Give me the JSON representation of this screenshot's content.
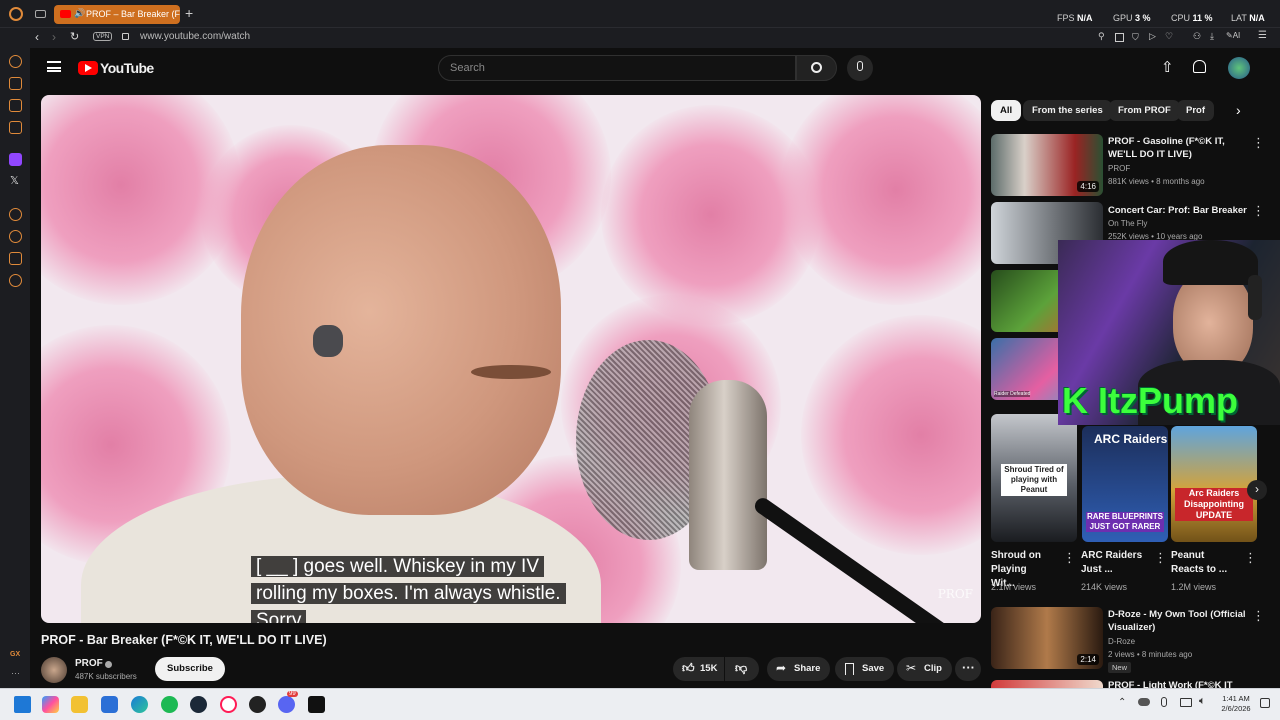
{
  "browser": {
    "tab_title": "PROF – Bar Breaker (F",
    "url": "www.youtube.com/watch",
    "vpn_label": "VPN",
    "stats": {
      "fps_label": "FPS",
      "fps": "N/A",
      "gpu_label": "GPU",
      "gpu": "3 %",
      "cpu_label": "CPU",
      "cpu": "11 %",
      "lat_label": "LAT",
      "lat": "N/A"
    },
    "ai_label": "AI",
    "sidebar_gx": "GX"
  },
  "youtube": {
    "logo_text": "YouTube",
    "search_placeholder": "Search",
    "chips": [
      "All",
      "From the series",
      "From PROF",
      "Prof"
    ],
    "video": {
      "title": "PROF - Bar Breaker (F*©K IT, WE'LL DO IT LIVE)",
      "captions": [
        "[ __ ] goes well. Whiskey in my IV",
        "rolling my boxes. I'm always whistle.",
        "Sorry"
      ],
      "watermark": "PROF",
      "channel": "PROF",
      "subscribers": "487K subscribers",
      "subscribe": "Subscribe",
      "likes": "15K",
      "share": "Share",
      "save": "Save",
      "clip": "Clip"
    },
    "recommendations": [
      {
        "title": "PROF - Gasoline (F*©K IT, WE'LL DO IT LIVE)",
        "channel": "PROF",
        "meta": "881K views • 8 months ago",
        "duration": "4:16"
      },
      {
        "title": "Concert Car: Prof: Bar Breaker",
        "channel": "On The Fly",
        "meta": "252K views • 10 years ago",
        "duration": ""
      },
      {
        "title": "D-Roze - My Own Tool (Official Visualizer)",
        "channel": "D-Roze",
        "meta": "2 views • 8 minutes ago",
        "duration": "2:14",
        "badge": "New"
      },
      {
        "title": "PROF - Light Work (F*©K IT",
        "channel": "",
        "meta": "",
        "duration": ""
      }
    ],
    "shorts": [
      {
        "title": "Shroud on Playing Wit...",
        "views": "2.1M views",
        "thumb_text": "Shroud Tired of playing with Peanut"
      },
      {
        "title": "ARC Raiders Just ...",
        "views": "214K views",
        "thumb_text": "RARE BLUEPRINTS JUST GOT RARER",
        "logo": "ARC Raiders"
      },
      {
        "title": "Peanut Reacts to ...",
        "views": "1.2M views",
        "thumb_text": "Arc Raiders Disappointing UPDATE"
      }
    ],
    "thumb_badge": "Raider Defeated"
  },
  "stream_overlay": {
    "name": "ItzPump"
  },
  "taskbar": {
    "time": "1:41 AM",
    "date": "2/6/2026",
    "discord_badge": "99"
  }
}
